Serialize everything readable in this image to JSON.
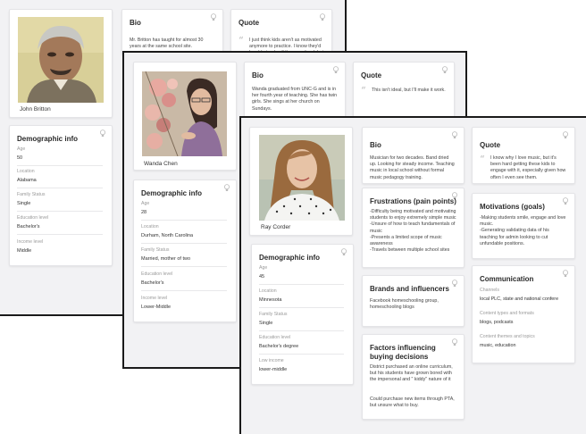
{
  "personas": [
    {
      "name": "John Britton",
      "bio_title": "Bio",
      "bio": "Mr. Britton has taught for almost 30 years at the same school site.",
      "quote_title": "Quote",
      "quote": "I just think kids aren't as motivated anymore to practice. I know they'd be able to play if they practiced, but most of them",
      "demo_title": "Demographic info",
      "demographics": [
        {
          "label": "Age",
          "value": "50"
        },
        {
          "label": "Location",
          "value": "Alabama"
        },
        {
          "label": "Family Status",
          "value": "Single"
        },
        {
          "label": "Education level",
          "value": "Bachelor's"
        },
        {
          "label": "Income level",
          "value": "Middle"
        }
      ]
    },
    {
      "name": "Wanda Chen",
      "bio_title": "Bio",
      "bio": "Wanda graduated from UNC-G and is in her fourth year of teaching. She has twin girls. She sings at her church on Sundays.",
      "quote_title": "Quote",
      "quote": "This isn't ideal, but I'll make it work.",
      "demo_title": "Demographic info",
      "demographics": [
        {
          "label": "Age",
          "value": "28"
        },
        {
          "label": "Location",
          "value": "Durham, North Carolina"
        },
        {
          "label": "Family Status",
          "value": "Married, mother of two"
        },
        {
          "label": "Education level",
          "value": "Bachelor's"
        },
        {
          "label": "Income level",
          "value": "Lower-Middle"
        }
      ]
    },
    {
      "name": "Ray Corder",
      "bio_title": "Bio",
      "bio": "Musician for two decades. Band dried up. Looking for steady income. Teaching music in local school without formal music pedagogy training.",
      "quote_title": "Quote",
      "quote": "I know why I love music, but it's been hard getting these kids to engage with it, especially given how often I even see them.",
      "demo_title": "Demographic info",
      "demographics": [
        {
          "label": "Age",
          "value": "45"
        },
        {
          "label": "Location",
          "value": "Minnesota"
        },
        {
          "label": "Family Status",
          "value": "Single"
        },
        {
          "label": "Education level",
          "value": "Bachelor's degree"
        },
        {
          "label": "Low income",
          "value": "lower-middle"
        }
      ],
      "frustrations_title": "Frustrations (pain points)",
      "frustrations": [
        "-Difficulty being motivated and motivating students to enjoy extremely simple music",
        "-Unsure of how to teach fundamentals of music",
        "-Presents a limited scope of music awareness",
        "-Travels between multiple school sites"
      ],
      "motivations_title": "Motivations (goals)",
      "motivations": [
        "-Making students smile, engage and love music.",
        "-Generating validating data of his teaching for admin looking to cut unfundable positions."
      ],
      "brands_title": "Brands and influencers",
      "brands": "Facebook homeschooling group, homeschooling blogs",
      "factors_title": "Factors influencing buying decisions",
      "factors_1": "District purchased an online curriculum, but his students have grown bored with the impersonal and \" kiddy\" nature of it",
      "factors_2": "Could purchase new items through PTA, but unsure what to buy.",
      "communication_title": "Communication",
      "communication": [
        {
          "label": "Channels",
          "value": "local PLC, state and national confere"
        },
        {
          "label": "Content types and formats",
          "value": "blogs, podcasts"
        },
        {
          "label": "Content themes and topics",
          "value": "music, education"
        }
      ]
    }
  ]
}
